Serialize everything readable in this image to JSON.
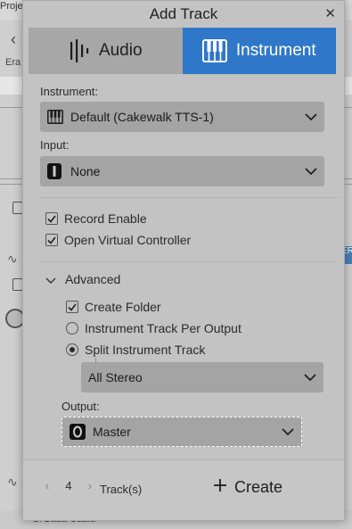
{
  "background": {
    "project_title_fragment": "Projec",
    "erase_label_fragment": "Era",
    "bottom_text_fragment": "Ci Baaa Caaia",
    "right_tag": "ER"
  },
  "dialog": {
    "title": "Add Track",
    "close_icon": "close-icon",
    "tabs": [
      {
        "label": "Audio",
        "icon": "audio-waveform-icon",
        "selected": false
      },
      {
        "label": "Instrument",
        "icon": "piano-keys-icon",
        "selected": true
      }
    ],
    "instrument": {
      "label": "Instrument:",
      "value": "Default (Cakewalk TTS-1)",
      "icon": "piano-keys-icon"
    },
    "input": {
      "label": "Input:",
      "value": "None",
      "icon": "input-none-icon"
    },
    "options": [
      {
        "label": "Record Enable",
        "checked": true
      },
      {
        "label": "Open Virtual Controller",
        "checked": true
      }
    ],
    "advanced": {
      "label": "Advanced",
      "expanded": true,
      "create_folder": {
        "label": "Create Folder",
        "checked": true
      },
      "mode_options": [
        {
          "label": "Instrument Track Per Output",
          "selected": false
        },
        {
          "label": "Split Instrument Track",
          "selected": true
        }
      ],
      "channel_format": "All Stereo"
    },
    "output": {
      "label": "Output:",
      "value": "Master",
      "icon": "output-bus-icon"
    },
    "footer": {
      "track_count": "4",
      "tracks_label": "Track(s)",
      "create_label": "Create"
    }
  },
  "colors": {
    "accent": "#2f77c8",
    "dialog_bg": "#c3c3c3",
    "dropdown_bg": "#a4a4a4"
  }
}
